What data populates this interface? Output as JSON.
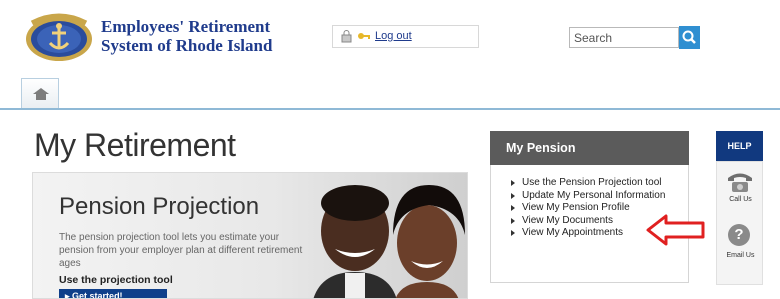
{
  "brand": {
    "line1": "Employees' Retirement",
    "line2": "System of Rhode Island",
    "logo_icon": "anchor-seal-icon"
  },
  "header": {
    "logout_label": "Log out",
    "search_placeholder": "Search",
    "icons": [
      "lock-icon",
      "key-icon",
      "search-icon"
    ]
  },
  "nav": {
    "home_icon": "home-icon"
  },
  "main": {
    "title": "My Retirement",
    "hero": {
      "title": "Pension Projection",
      "description": "The pension projection tool lets you estimate your pension from your employer plan at different retirement ages",
      "link_label": "Use the projection tool",
      "cta_label": "Get started!"
    }
  },
  "pension_panel": {
    "title": "My Pension",
    "items": [
      "Use the Pension Projection tool",
      "Update My Personal Information",
      "View My Pension Profile",
      "View My Documents",
      "View My Appointments"
    ]
  },
  "help": {
    "title": "HELP",
    "call_label": "Call Us",
    "email_label": "Email Us"
  },
  "colors": {
    "brand_blue": "#1f3b8c",
    "panel_header": "#5b5b5b",
    "help_header": "#11397f",
    "search_button": "#2f8fd1",
    "annotation_arrow": "#e02020"
  }
}
